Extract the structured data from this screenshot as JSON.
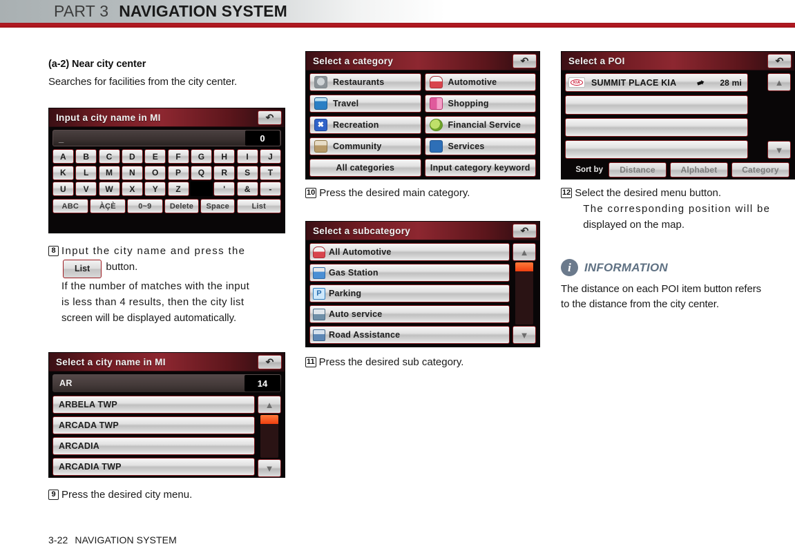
{
  "header": {
    "part": "PART 3",
    "title": "NAVIGATION SYSTEM"
  },
  "footer": {
    "page": "3-22",
    "section": "NAVIGATION SYSTEM"
  },
  "left_column": {
    "subheading": "(a-2) Near city center",
    "intro": "Searches for facilities from the city center.",
    "keyboard_screen": {
      "title": "Input a city name in MI",
      "back_icon": "back-arrow-icon",
      "input_value": "_",
      "match_count": "0",
      "rows": [
        [
          "A",
          "B",
          "C",
          "D",
          "E",
          "F",
          "G",
          "H",
          "I",
          "J"
        ],
        [
          "K",
          "L",
          "M",
          "N",
          "O",
          "P",
          "Q",
          "R",
          "S",
          "T"
        ],
        [
          "U",
          "V",
          "W",
          "X",
          "Y",
          "Z",
          "",
          "'",
          "&",
          "-"
        ]
      ],
      "function_keys": [
        "ABC",
        "ÀÇÈ",
        "0~9",
        "Delete",
        "Space",
        "List"
      ]
    },
    "step8": {
      "number": "8",
      "text_before": "Input the city name and press the",
      "button_label": "List",
      "text_after": "button.",
      "note_lines": [
        "If the number of matches with the input",
        "is less than 4 results, then the city list",
        "screen will be displayed automatically."
      ]
    },
    "city_list_screen": {
      "title": "Select a city name in MI",
      "back_icon": "back-arrow-icon",
      "search_text": "AR",
      "result_count": "14",
      "items": [
        "ARBELA TWP",
        "ARCADA TWP",
        "ARCADIA",
        "ARCADIA TWP"
      ],
      "scroll_up_icon": "double-chevron-up-icon",
      "scroll_down_icon": "double-chevron-down-icon"
    },
    "step9": {
      "number": "9",
      "text": "Press the desired city menu."
    }
  },
  "mid_column": {
    "category_screen": {
      "title": "Select a category",
      "back_icon": "back-arrow-icon",
      "items": [
        {
          "label": "Restaurants",
          "icon": "restaurant-icon",
          "color": "#9aa0a4"
        },
        {
          "label": "Automotive",
          "icon": "car-icon",
          "color": "#d8454d"
        },
        {
          "label": "Travel",
          "icon": "luggage-icon",
          "color": "#2a7fc4"
        },
        {
          "label": "Shopping",
          "icon": "shopping-bag-icon",
          "color": "#e05a9c"
        },
        {
          "label": "Recreation",
          "icon": "recreation-icon",
          "color": "#2f63c8"
        },
        {
          "label": "Financial Service",
          "icon": "finance-globe-icon",
          "color": "#8ec63f"
        },
        {
          "label": "Community",
          "icon": "community-icon",
          "color": "#b79a6a"
        },
        {
          "label": "Services",
          "icon": "services-icon",
          "color": "#2e6fb7"
        }
      ],
      "footer_buttons": [
        "All categories",
        "Input category keyword"
      ]
    },
    "step10": {
      "number": "10",
      "text": "Press the desired main category."
    },
    "subcategory_screen": {
      "title": "Select a subcategory",
      "back_icon": "back-arrow-icon",
      "items": [
        {
          "label": "All Automotive",
          "icon": "car-icon",
          "color": "#d8454d"
        },
        {
          "label": "Gas Station",
          "icon": "gas-pump-icon",
          "color": "#4a8fd4"
        },
        {
          "label": "Parking",
          "icon": "parking-p-icon",
          "color": "#3aa0e0"
        },
        {
          "label": "Auto service",
          "icon": "auto-service-icon",
          "color": "#6f8fa8"
        },
        {
          "label": "Road Assistance",
          "icon": "tow-truck-icon",
          "color": "#5d87b5"
        }
      ],
      "scroll_up_icon": "double-chevron-up-icon",
      "scroll_down_icon": "double-chevron-down-icon"
    },
    "step11": {
      "number": "11",
      "text": "Press the desired sub category."
    }
  },
  "right_column": {
    "poi_screen": {
      "title": "Select a POI",
      "back_icon": "back-arrow-icon",
      "items": [
        {
          "name": "SUMMIT PLACE KIA",
          "brand": "KIA",
          "distance": "28 mi",
          "direction_icon": "direction-arrow-icon"
        },
        {
          "name": "",
          "brand": "",
          "distance": "",
          "direction_icon": ""
        },
        {
          "name": "",
          "brand": "",
          "distance": "",
          "direction_icon": ""
        },
        {
          "name": "",
          "brand": "",
          "distance": "",
          "direction_icon": ""
        }
      ],
      "sort_label": "Sort by",
      "sort_buttons": [
        "Distance",
        "Alphabet",
        "Category"
      ],
      "scroll_up_icon": "double-chevron-up-icon",
      "scroll_down_icon": "double-chevron-down-icon"
    },
    "step12": {
      "number": "12",
      "text": "Select the desired menu button.",
      "note_lines": [
        "The corresponding position will be",
        "displayed on the map."
      ]
    },
    "information": {
      "icon": "info-icon",
      "label": "INFORMATION",
      "lines": [
        "The distance on each POI item button refers",
        "to the distance from the city center."
      ]
    }
  }
}
